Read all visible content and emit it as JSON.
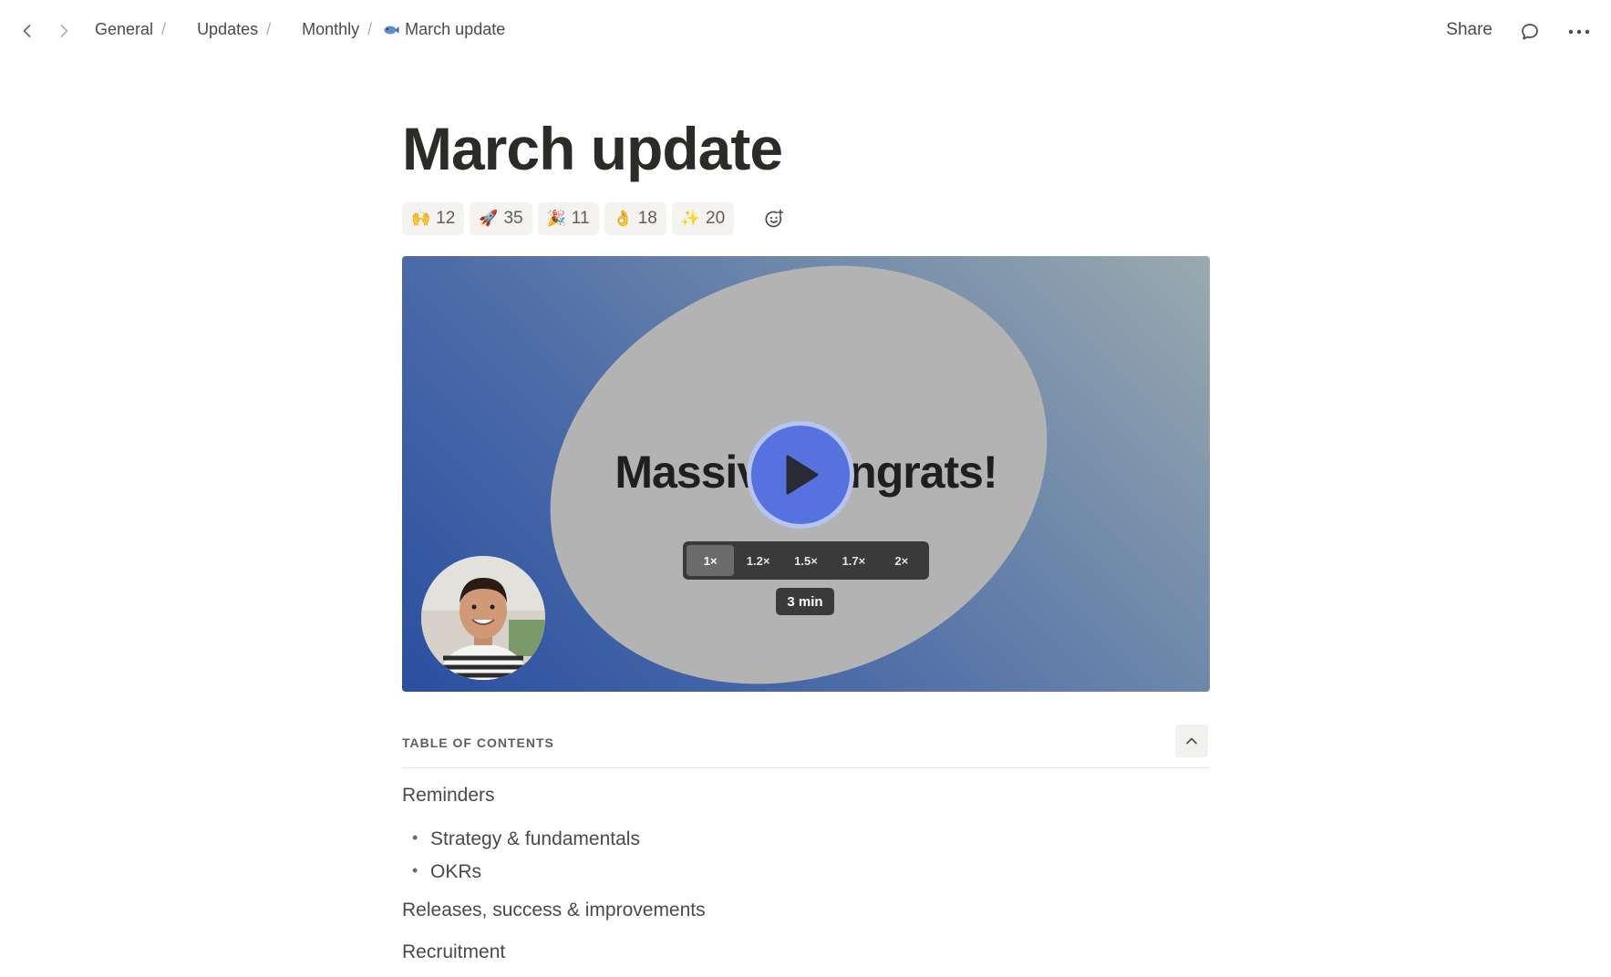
{
  "breadcrumb": {
    "items": [
      "General",
      "Updates",
      "Monthly"
    ],
    "current": "March update",
    "separator": "/"
  },
  "header": {
    "share_label": "Share"
  },
  "page": {
    "title": "March update"
  },
  "reactions": [
    {
      "emoji": "🙌",
      "count": "12"
    },
    {
      "emoji": "🚀",
      "count": "35"
    },
    {
      "emoji": "🎉",
      "count": "11"
    },
    {
      "emoji": "👌",
      "count": "18"
    },
    {
      "emoji": "✨",
      "count": "20"
    }
  ],
  "video": {
    "text": "Massive congrats!",
    "speeds": [
      "1×",
      "1.2×",
      "1.5×",
      "1.7×",
      "2×"
    ],
    "active_speed": "1×",
    "duration": "3 min"
  },
  "toc": {
    "label": "TABLE OF CONTENTS",
    "items": [
      {
        "label": "Reminders",
        "children": [
          "Strategy & fundamentals",
          "OKRs"
        ]
      },
      {
        "label": "Releases, success & improvements"
      },
      {
        "label": "Recruitment"
      }
    ]
  },
  "colors": {
    "play_button": "#5572de",
    "video_gradient_start": "#2a4fa0",
    "video_gradient_end": "#9aaab0"
  }
}
